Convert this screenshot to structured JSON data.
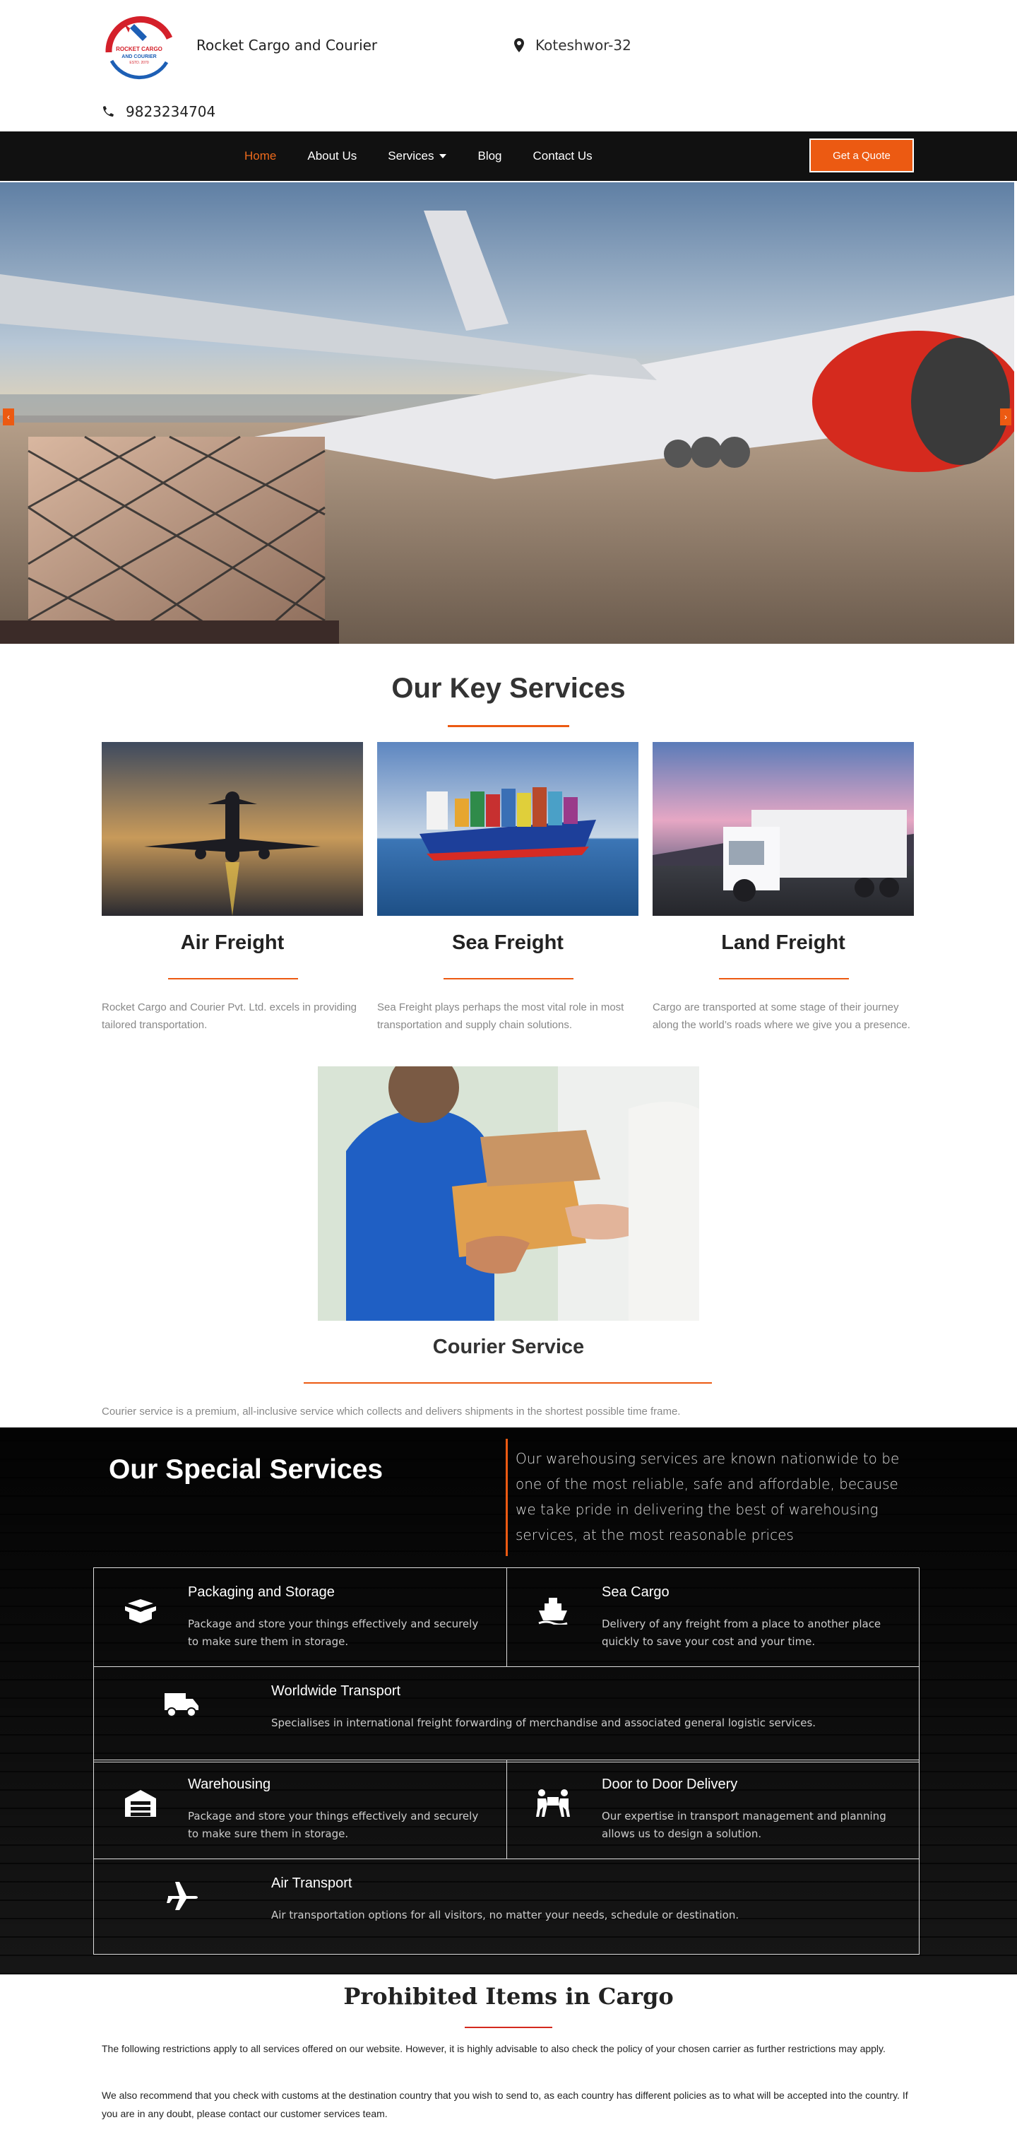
{
  "header": {
    "brand": "Rocket Cargo and Courier",
    "location": "Koteshwor-32",
    "phone": "9823234704",
    "logo_text": [
      "ROCKET CARGO",
      "AND COURIER",
      "ESTD. 2070"
    ]
  },
  "nav": {
    "items": [
      "Home",
      "About Us",
      "Services",
      "Blog",
      "Contact Us"
    ],
    "quote": "Get a Quote"
  },
  "key_services": {
    "title": "Our Key Services",
    "cards": [
      {
        "title": "Air Freight",
        "text": "Rocket Cargo and Courier Pvt. Ltd. excels in providing tailored transportation."
      },
      {
        "title": "Sea Freight",
        "text": "Sea Freight plays perhaps the most vital role in most transportation and supply chain solutions."
      },
      {
        "title": "Land Freight",
        "text": "Cargo are transported at some stage of their journey along the world’s roads where we give you a presence."
      }
    ],
    "courier": {
      "title": "Courier Service",
      "text": "Courier service is a premium, all-inclusive service which collects and delivers shipments in the shortest possible time frame."
    }
  },
  "special": {
    "title": "Our Special Services",
    "intro": "Our warehousing services are known nationwide to be one of the most reliable, safe and affordable, because we take pride in delivering the best of warehousing services, at the most reasonable prices",
    "items": [
      {
        "title": "Packaging and Storage",
        "desc": "Package and store your things effectively and securely to make sure them in storage.",
        "icon": "box-open-icon"
      },
      {
        "title": "Sea Cargo",
        "desc": "Delivery of any freight from a place to another place quickly to save your cost and your time.",
        "icon": "ship-icon"
      },
      {
        "title": "Worldwide Transport",
        "desc": "Specialises in international freight forwarding of merchandise and associated general logistic services.",
        "icon": "truck-icon"
      },
      {
        "title": "Warehousing",
        "desc": "Package and store your things effectively and securely to make sure them in storage.",
        "icon": "warehouse-icon"
      },
      {
        "title": "Door to Door Delivery",
        "desc": "Our expertise in transport management and planning allows us to design a solution.",
        "icon": "people-carry-icon"
      },
      {
        "title": "Air Transport",
        "desc": "Air transportation options for all visitors, no matter your needs, schedule or destination.",
        "icon": "plane-icon"
      }
    ]
  },
  "prohibited": {
    "title": "Prohibited Items in Cargo",
    "p1": "The following restrictions apply to all services offered on our website. However, it is highly advisable to also check the policy of your chosen carrier as further restrictions may apply.",
    "p2": "We also recommend that you check with customs at the destination country that you wish to send to, as each country has different policies as to what will be accepted into the country. If you are in any doubt, please contact our customer services team."
  },
  "colors": {
    "accent": "#ec5a12",
    "nav_bg": "#111111"
  }
}
